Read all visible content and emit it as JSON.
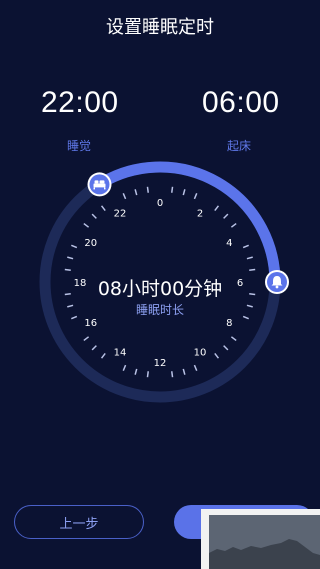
{
  "header": {
    "title": "设置睡眠定时"
  },
  "sleep": {
    "time": "22:00",
    "label": "睡觉"
  },
  "wake": {
    "time": "06:00",
    "label": "起床"
  },
  "dial": {
    "hour_labels": [
      "0",
      "2",
      "4",
      "6",
      "8",
      "10",
      "12",
      "14",
      "16",
      "18",
      "20",
      "22"
    ],
    "duration": "08小时00分钟",
    "duration_label": "睡眠时长",
    "colors": {
      "track": "#1d2a58",
      "arc": "#5b74ea",
      "tick": "#b9c2e6",
      "face": "#0b1232"
    },
    "sleep_icon": "bed-icon",
    "wake_icon": "bell-icon"
  },
  "footer": {
    "prev_label": "上一步"
  }
}
